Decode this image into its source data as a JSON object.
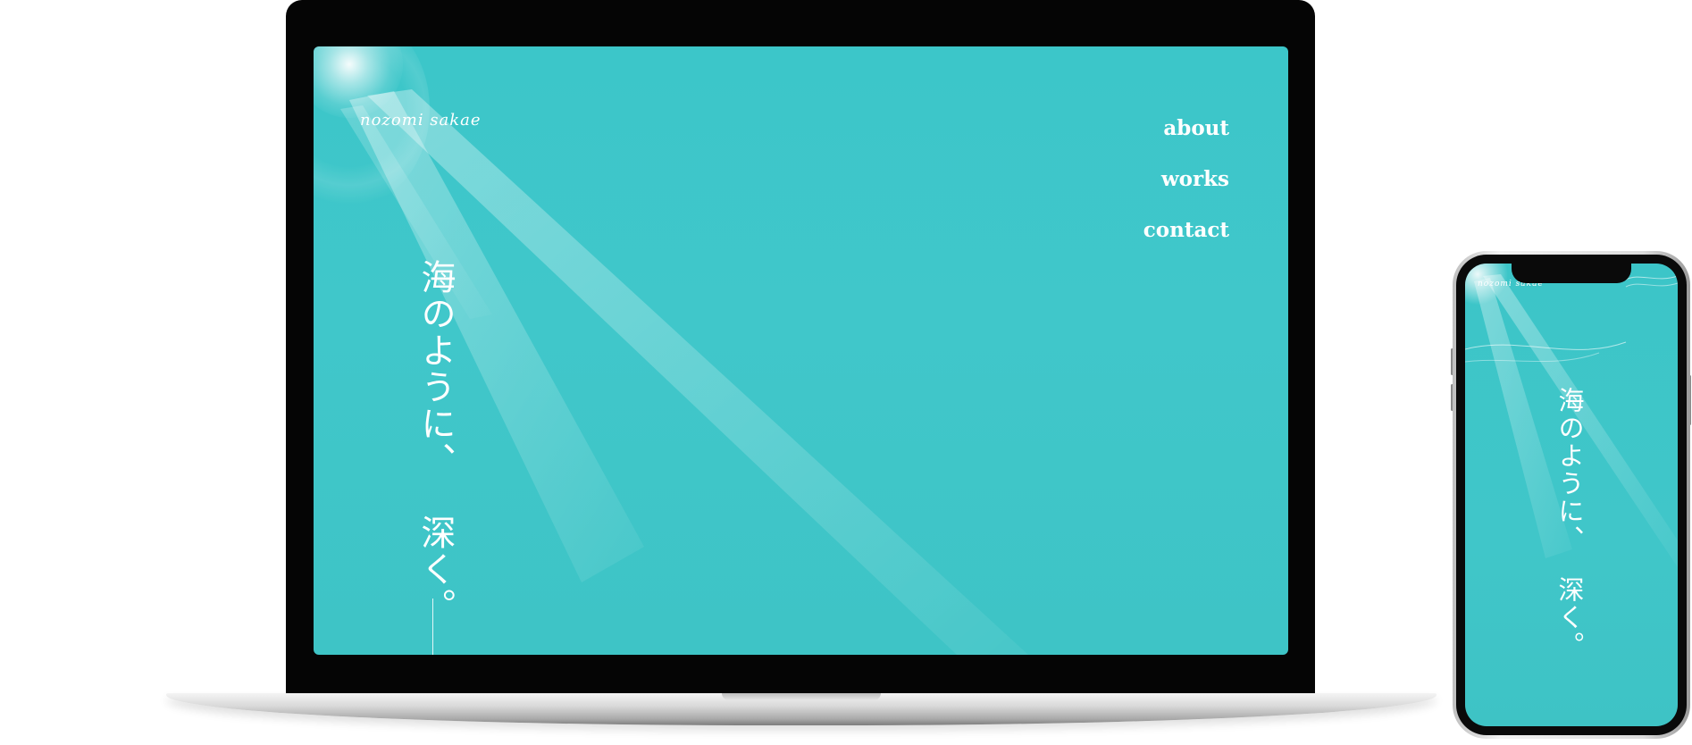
{
  "site": {
    "logo_text": "nozomi sakae",
    "nav": [
      {
        "label": "about"
      },
      {
        "label": "works"
      },
      {
        "label": "contact"
      }
    ],
    "tagline_part1": "海のように、",
    "tagline_part2": "深く。"
  },
  "colors": {
    "sea": "#3fc6c9",
    "text": "#ffffff",
    "bezel": "#050505"
  }
}
